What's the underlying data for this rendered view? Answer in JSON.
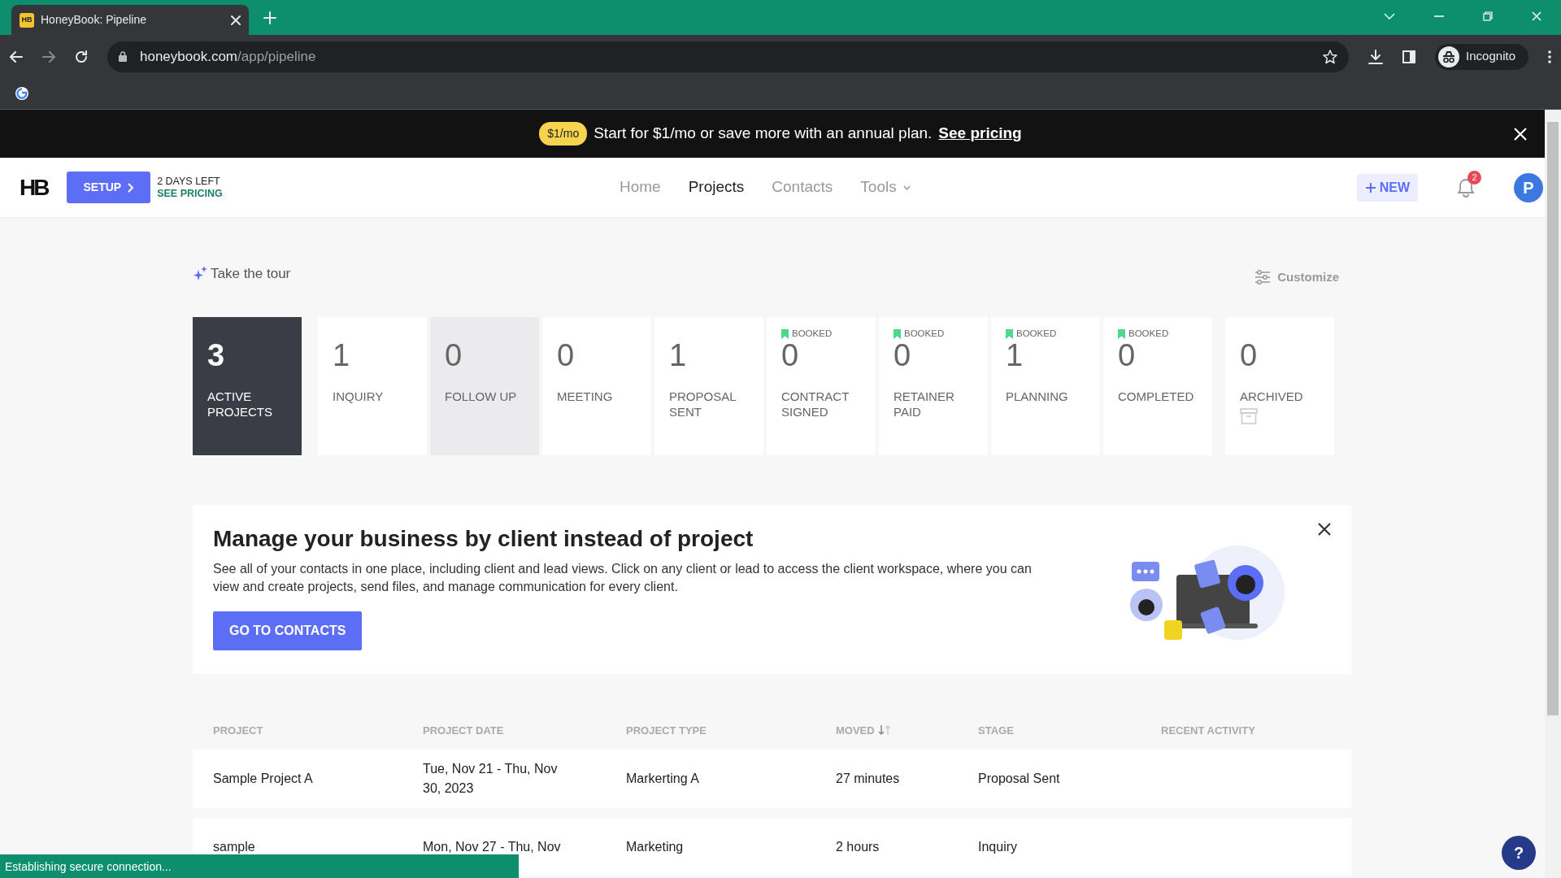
{
  "browser": {
    "tab": {
      "favicon": "HB",
      "title": "HoneyBook: Pipeline"
    },
    "url_host": "honeybook.com",
    "url_path": "/app/pipeline",
    "profile": "Incognito"
  },
  "promo": {
    "badge": "$1/mo",
    "text": "Start for $1/mo or save more with an annual plan.",
    "link": "See pricing"
  },
  "header": {
    "logo": "HB",
    "setup": "SETUP",
    "trial_days": "2 DAYS LEFT",
    "trial_link": "SEE PRICING",
    "nav": [
      {
        "label": "Home",
        "selected": false,
        "kind": "link"
      },
      {
        "label": "Projects",
        "selected": true,
        "kind": "link"
      },
      {
        "label": "Contacts",
        "selected": false,
        "kind": "link"
      },
      {
        "label": "Tools",
        "selected": false,
        "kind": "dropdown"
      }
    ],
    "new_button": "NEW",
    "notifications": "2",
    "avatar": "P"
  },
  "toolbar": {
    "tour": "Take the tour",
    "customize": "Customize"
  },
  "stages": [
    {
      "count": "3",
      "label": "ACTIVE PROJECTS",
      "kind": "total",
      "selected": true,
      "highlighted": false,
      "booked": false
    },
    {
      "count": "1",
      "label": "INQUIRY",
      "kind": "stage",
      "selected": false,
      "highlighted": false,
      "booked": false
    },
    {
      "count": "0",
      "label": "FOLLOW UP",
      "kind": "stage",
      "selected": false,
      "highlighted": true,
      "booked": false
    },
    {
      "count": "0",
      "label": "MEETING",
      "kind": "stage",
      "selected": false,
      "highlighted": false,
      "booked": false
    },
    {
      "count": "1",
      "label": "PROPOSAL SENT",
      "kind": "stage",
      "selected": false,
      "highlighted": false,
      "booked": false
    },
    {
      "count": "0",
      "label": "CONTRACT SIGNED",
      "kind": "stage",
      "selected": false,
      "highlighted": false,
      "booked": true,
      "tag": "BOOKED"
    },
    {
      "count": "0",
      "label": "RETAINER PAID",
      "kind": "stage",
      "selected": false,
      "highlighted": false,
      "booked": true,
      "tag": "BOOKED"
    },
    {
      "count": "1",
      "label": "PLANNING",
      "kind": "stage",
      "selected": false,
      "highlighted": false,
      "booked": true,
      "tag": "BOOKED"
    },
    {
      "count": "0",
      "label": "COMPLETED",
      "kind": "stage",
      "selected": false,
      "highlighted": false,
      "booked": true,
      "tag": "BOOKED"
    },
    {
      "count": "0",
      "label": "ARCHIVED",
      "kind": "archive",
      "selected": false,
      "highlighted": false,
      "booked": false
    }
  ],
  "banner": {
    "title": "Manage your business by client instead of project",
    "text": "See all of your contacts in one place, including client and lead views. Click on any client or lead to access the client workspace, where you can view and create projects, send files, and manage communication for every client.",
    "button": "GO TO CONTACTS"
  },
  "table": {
    "columns": [
      {
        "label": "PROJECT",
        "sorted": false
      },
      {
        "label": "PROJECT DATE",
        "sorted": false
      },
      {
        "label": "PROJECT TYPE",
        "sorted": false
      },
      {
        "label": "MOVED",
        "sorted": true
      },
      {
        "label": "STAGE",
        "sorted": false
      },
      {
        "label": "RECENT ACTIVITY",
        "sorted": false
      }
    ],
    "rows": [
      [
        "Sample Project A",
        "Tue, Nov 21 - Thu, Nov 30, 2023",
        "Markerting A",
        "27 minutes",
        "Proposal Sent"
      ],
      [
        "sample",
        "Mon, Nov 27 - Thu, Nov",
        "Marketing",
        "2 hours",
        "Inquiry"
      ]
    ]
  },
  "status_bar": "Establishing secure connection...",
  "help": "?"
}
